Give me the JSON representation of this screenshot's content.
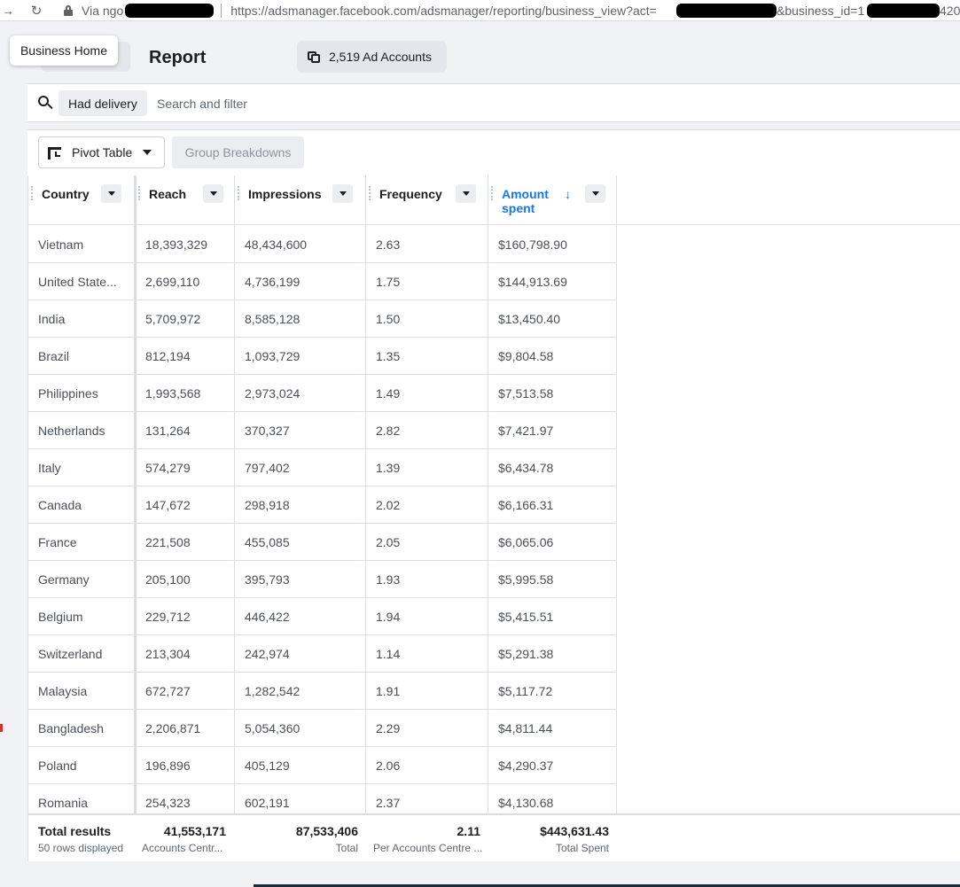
{
  "browser": {
    "site_label": "Via ngo",
    "url": "https://adsmanager.facebook.com/adsmanager/reporting/business_view?act=",
    "url_tail": "&business_id=1",
    "url_end": "420"
  },
  "header": {
    "tooltip": "Business Home",
    "title": "Report",
    "accounts_label": "2,519 Ad Accounts"
  },
  "search": {
    "chip": "Had delivery",
    "placeholder": "Search and filter"
  },
  "toolbar": {
    "pivot_label": "Pivot Table",
    "group_label": "Group Breakdowns"
  },
  "table": {
    "columns": [
      "Country",
      "Reach",
      "Impressions",
      "Frequency",
      "Amount spent"
    ],
    "rows": [
      [
        "Vietnam",
        "18,393,329",
        "48,434,600",
        "2.63",
        "$160,798.90"
      ],
      [
        "United State...",
        "2,699,110",
        "4,736,199",
        "1.75",
        "$144,913.69"
      ],
      [
        "India",
        "5,709,972",
        "8,585,128",
        "1.50",
        "$13,450.40"
      ],
      [
        "Brazil",
        "812,194",
        "1,093,729",
        "1.35",
        "$9,804.58"
      ],
      [
        "Philippines",
        "1,993,568",
        "2,973,024",
        "1.49",
        "$7,513.58"
      ],
      [
        "Netherlands",
        "131,264",
        "370,327",
        "2.82",
        "$7,421.97"
      ],
      [
        "Italy",
        "574,279",
        "797,402",
        "1.39",
        "$6,434.78"
      ],
      [
        "Canada",
        "147,672",
        "298,918",
        "2.02",
        "$6,166.31"
      ],
      [
        "France",
        "221,508",
        "455,085",
        "2.05",
        "$6,065.06"
      ],
      [
        "Germany",
        "205,100",
        "395,793",
        "1.93",
        "$5,995.58"
      ],
      [
        "Belgium",
        "229,712",
        "446,422",
        "1.94",
        "$5,415.51"
      ],
      [
        "Switzerland",
        "213,304",
        "242,974",
        "1.14",
        "$5,291.38"
      ],
      [
        "Malaysia",
        "672,727",
        "1,282,542",
        "1.91",
        "$5,117.72"
      ],
      [
        "Bangladesh",
        "2,206,871",
        "5,054,360",
        "2.29",
        "$4,811.44"
      ],
      [
        "Poland",
        "196,896",
        "405,129",
        "2.06",
        "$4,290.37"
      ],
      [
        "Romania",
        "254,323",
        "602,191",
        "2.37",
        "$4,130.68"
      ]
    ],
    "totals": {
      "label": "Total results",
      "rows_displayed": "50 rows displayed",
      "reach": "41,553,171",
      "reach_sub": "Accounts Centr...",
      "impressions": "87,533,406",
      "impressions_sub": "Total",
      "frequency": "2.11",
      "frequency_sub": "Per Accounts Centre ...",
      "amount": "$443,631.43",
      "amount_sub": "Total Spent"
    }
  }
}
